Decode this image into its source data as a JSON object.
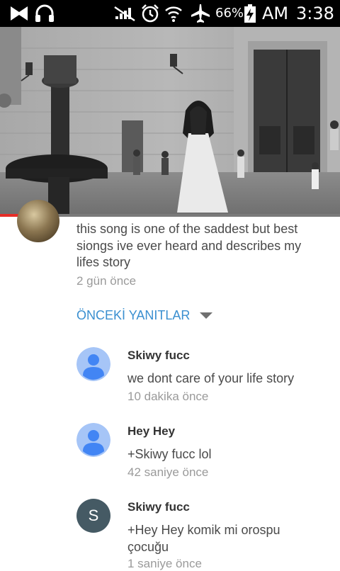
{
  "status_bar": {
    "battery": "66%",
    "am_pm": "AM",
    "time": "3:38",
    "icons": [
      "app-bow-icon",
      "headphones-icon",
      "signal-muted-icon",
      "alarm-icon",
      "wifi-icon",
      "airplane-icon",
      "battery-charging-icon"
    ]
  },
  "video": {
    "progress_fraction": 0.17
  },
  "comment": {
    "text": "this song is one of the saddest but best siongs ive ever heard and describes my lifes story",
    "time": "2 gün önce"
  },
  "previous_replies_label": "ÖNCEKİ YANITLAR",
  "replies": [
    {
      "author": "Skiwy fucc",
      "text": "we dont care of your life story",
      "time": "10 dakika önce",
      "avatar": "default-person-icon"
    },
    {
      "author": "Hey Hey",
      "text": "+Skiwy fucc lol",
      "time": "42 saniye önce",
      "avatar": "default-person-icon"
    },
    {
      "author": "Skiwy fucc",
      "text": "+Hey Hey komik mi orospu çocuğu",
      "time": "1 saniye önce",
      "avatar": "S",
      "avatar_color": "#455a64"
    }
  ],
  "colors": {
    "link_blue": "#3a8fd0",
    "progress_red": "#e52d27",
    "avatar_blue": "#4285f4",
    "avatar_blue_bg": "#a6c5f7"
  }
}
